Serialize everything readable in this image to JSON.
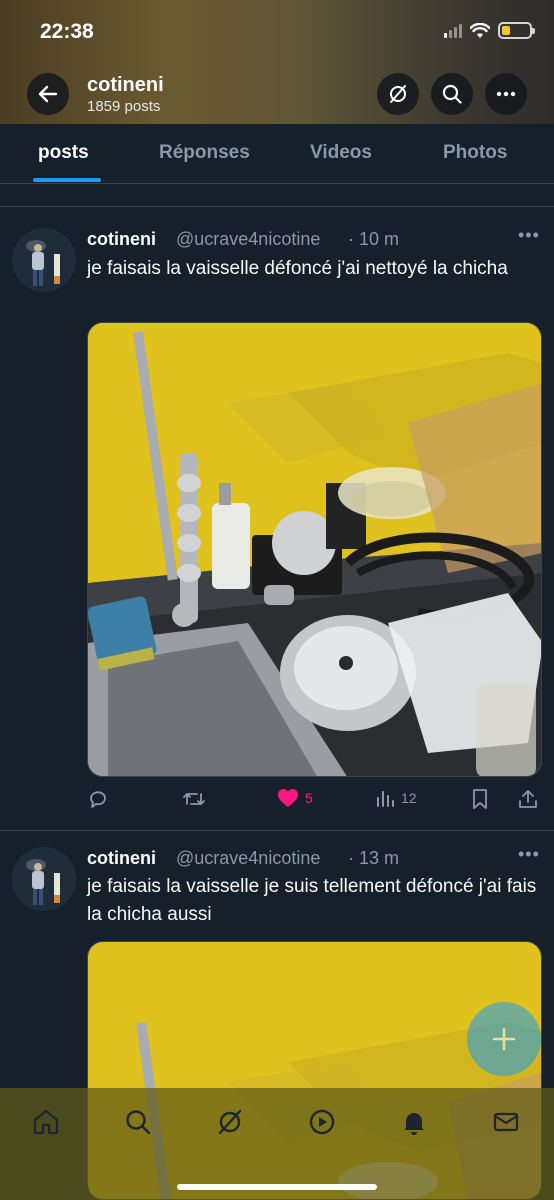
{
  "status_bar": {
    "time": "22:38"
  },
  "profile": {
    "name": "cotineni",
    "post_count": "1859 posts"
  },
  "tabs": [
    {
      "label": "posts",
      "active": true
    },
    {
      "label": "Réponses",
      "active": false
    },
    {
      "label": "Videos",
      "active": false
    },
    {
      "label": "Photos",
      "active": false
    }
  ],
  "posts": [
    {
      "name": "cotineni",
      "handle": "@ucrave4nicotine",
      "time": "· 10 m",
      "text": "je faisais la vaisselle défoncé j'ai nettoyé la chicha",
      "likes": "5",
      "views": "12"
    },
    {
      "name": "cotineni",
      "handle": "@ucrave4nicotine",
      "time": "· 13 m",
      "text": "je faisais la vaisselle je suis tellement défoncé j'ai fais la chicha aussi"
    }
  ],
  "colors": {
    "accent": "#1d9bf0",
    "like": "#f91880",
    "background": "#15202b"
  },
  "icons": [
    "back-arrow-icon",
    "grok-icon",
    "search-icon",
    "more-icon",
    "reply-icon",
    "repost-icon",
    "heart-icon",
    "views-icon",
    "bookmark-icon",
    "share-icon",
    "compose-icon",
    "home-icon",
    "notifications-icon",
    "messages-icon",
    "video-icon"
  ]
}
